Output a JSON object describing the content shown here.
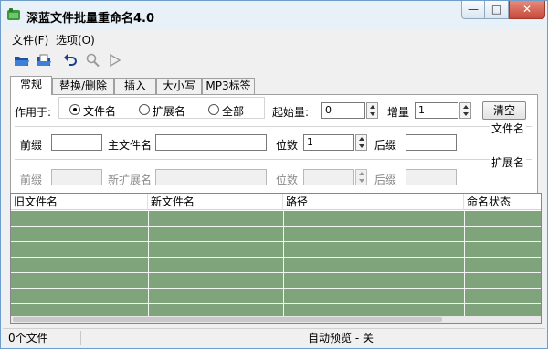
{
  "window": {
    "title": "深蓝文件批量重命名4.0",
    "controls": {
      "minimize": "—",
      "maximize": "□",
      "close": "✕"
    },
    "accent_color": "#6f9cc8"
  },
  "menu": [
    {
      "label": "文件(F)"
    },
    {
      "label": "选项(O)"
    }
  ],
  "toolbar": [
    {
      "icon": "open-folder-icon"
    },
    {
      "icon": "open-files-icon"
    },
    {
      "icon": "undo-icon"
    },
    {
      "icon": "preview-search-icon"
    },
    {
      "icon": "run-icon"
    }
  ],
  "tabs": [
    {
      "label": "常规",
      "active": true
    },
    {
      "label": "替换/删除"
    },
    {
      "label": "插入"
    },
    {
      "label": "大小写"
    },
    {
      "label": "MP3标签"
    }
  ],
  "general": {
    "apply_to_label": "作用于:",
    "apply_options": [
      {
        "label": "文件名",
        "checked": true
      },
      {
        "label": "扩展名",
        "checked": false
      },
      {
        "label": "全部",
        "checked": false
      }
    ],
    "start_label": "起始量:",
    "start_value": "0",
    "increment_label": "增量",
    "increment_value": "1",
    "clear_button": "清空",
    "filename_group": {
      "title": "文件名",
      "prefix_label": "前缀",
      "prefix_value": "",
      "main_label": "主文件名",
      "main_value": "",
      "digits_label": "位数",
      "digits_value": "1",
      "suffix_label": "后缀",
      "suffix_value": ""
    },
    "extension_group": {
      "title": "扩展名",
      "prefix_label": "前缀",
      "new_ext_label": "新扩展名",
      "digits_label": "位数",
      "suffix_label": "后缀"
    }
  },
  "file_list": {
    "columns": [
      "旧文件名",
      "新文件名",
      "路径",
      "命名状态"
    ],
    "rows": [],
    "background_color": "#7fa37b"
  },
  "status": {
    "file_count": "0个文件",
    "auto_preview": "自动预览 - 关"
  }
}
